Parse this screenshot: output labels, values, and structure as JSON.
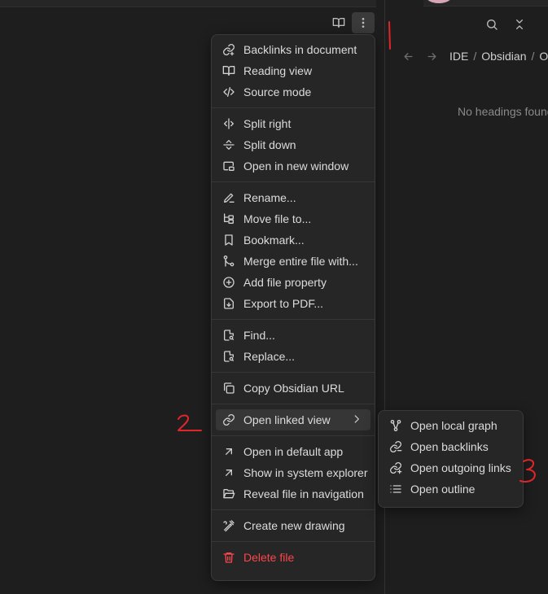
{
  "toolbar": {
    "reading_icon": "book-open-icon",
    "more_icon": "more-vertical-icon",
    "search_icon": "search-icon",
    "collapse_icon": "collapse-all-icon"
  },
  "breadcrumb": {
    "items": [
      "IDE",
      "Obsidian",
      "O"
    ],
    "separator": "/"
  },
  "outline": {
    "empty_text": "No headings found"
  },
  "menu": {
    "groups": [
      [
        {
          "label": "Backlinks in document",
          "icon": "link-icon"
        },
        {
          "label": "Reading view",
          "icon": "book-open-icon"
        },
        {
          "label": "Source mode",
          "icon": "code-icon"
        }
      ],
      [
        {
          "label": "Split right",
          "icon": "split-vertical-icon"
        },
        {
          "label": "Split down",
          "icon": "split-horizontal-icon"
        },
        {
          "label": "Open in new window",
          "icon": "window-icon"
        }
      ],
      [
        {
          "label": "Rename...",
          "icon": "pencil-icon"
        },
        {
          "label": "Move file to...",
          "icon": "folder-tree-icon"
        },
        {
          "label": "Bookmark...",
          "icon": "bookmark-icon"
        },
        {
          "label": "Merge entire file with...",
          "icon": "git-merge-icon"
        },
        {
          "label": "Add file property",
          "icon": "plus-circle-icon"
        },
        {
          "label": "Export to PDF...",
          "icon": "file-download-icon"
        }
      ],
      [
        {
          "label": "Find...",
          "icon": "file-search-icon"
        },
        {
          "label": "Replace...",
          "icon": "file-replace-icon"
        }
      ],
      [
        {
          "label": "Copy Obsidian URL",
          "icon": "copy-icon"
        }
      ],
      [
        {
          "label": "Open linked view",
          "icon": "link-icon"
        }
      ],
      [
        {
          "label": "Open in default app",
          "icon": "arrow-up-right-icon"
        },
        {
          "label": "Show in system explorer",
          "icon": "arrow-up-right-icon"
        },
        {
          "label": "Reveal file in navigation",
          "icon": "folder-open-icon"
        }
      ],
      [
        {
          "label": "Create new drawing",
          "icon": "drawing-icon"
        }
      ],
      [
        {
          "label": "Delete file",
          "icon": "trash-icon"
        }
      ]
    ]
  },
  "submenu": {
    "items": [
      {
        "label": "Open local graph",
        "icon": "graph-icon"
      },
      {
        "label": "Open backlinks",
        "icon": "link-in-icon"
      },
      {
        "label": "Open outgoing links",
        "icon": "link-out-icon"
      },
      {
        "label": "Open outline",
        "icon": "list-icon"
      }
    ]
  },
  "annotations": [
    "1",
    "2",
    "3"
  ],
  "colors": {
    "background": "#1e1e1e",
    "menu": "#262626",
    "danger": "#fb464c",
    "annotation": "#e0262a"
  }
}
